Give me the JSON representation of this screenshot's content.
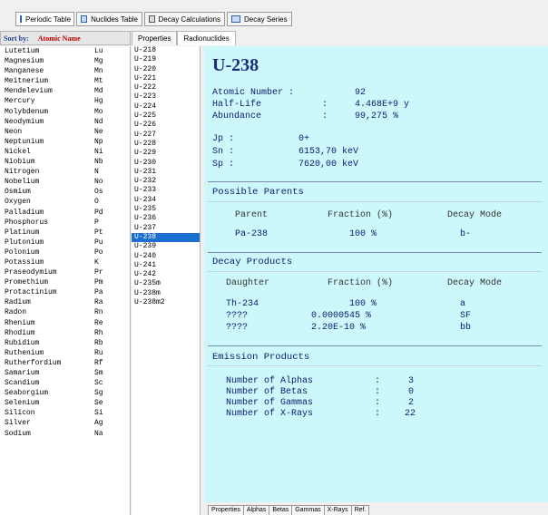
{
  "top_tabs": [
    {
      "label": "Periodic Table",
      "icon": "periodic-table-icon"
    },
    {
      "label": "Nuclides Table",
      "icon": "nuclides-table-icon"
    },
    {
      "label": "Decay Calculations",
      "icon": "calculator-icon"
    },
    {
      "label": "Decay Series",
      "icon": "decay-series-icon"
    }
  ],
  "sort": {
    "label": "Sort by:",
    "value": "Atomic Name"
  },
  "sub_tabs": [
    {
      "label": "Properties"
    },
    {
      "label": "Radionuclides"
    }
  ],
  "elements": [
    {
      "name": "Lutetium",
      "symbol": "Lu"
    },
    {
      "name": "Magnesium",
      "symbol": "Mg"
    },
    {
      "name": "Manganese",
      "symbol": "Mn"
    },
    {
      "name": "Meitnerium",
      "symbol": "Mt"
    },
    {
      "name": "Mendelevium",
      "symbol": "Md"
    },
    {
      "name": "Mercury",
      "symbol": "Hg"
    },
    {
      "name": "Molybdenum",
      "symbol": "Mo"
    },
    {
      "name": "Neodymium",
      "symbol": "Nd"
    },
    {
      "name": "Neon",
      "symbol": "Ne"
    },
    {
      "name": "Neptunium",
      "symbol": "Np"
    },
    {
      "name": "Nickel",
      "symbol": "Ni"
    },
    {
      "name": "Niobium",
      "symbol": "Nb"
    },
    {
      "name": "Nitrogen",
      "symbol": "N"
    },
    {
      "name": "Nobelium",
      "symbol": "No"
    },
    {
      "name": "Osmium",
      "symbol": "Os"
    },
    {
      "name": "Oxygen",
      "symbol": "O"
    },
    {
      "name": "Palladium",
      "symbol": "Pd"
    },
    {
      "name": "Phosphorus",
      "symbol": "P"
    },
    {
      "name": "Platinum",
      "symbol": "Pt"
    },
    {
      "name": "Plutonium",
      "symbol": "Pu"
    },
    {
      "name": "Polonium",
      "symbol": "Po"
    },
    {
      "name": "Potassium",
      "symbol": "K"
    },
    {
      "name": "Praseodymium",
      "symbol": "Pr"
    },
    {
      "name": "Promethium",
      "symbol": "Pm"
    },
    {
      "name": "Protactinium",
      "symbol": "Pa"
    },
    {
      "name": "Radium",
      "symbol": "Ra"
    },
    {
      "name": "Radon",
      "symbol": "Rn"
    },
    {
      "name": "Rhenium",
      "symbol": "Re"
    },
    {
      "name": "Rhodium",
      "symbol": "Rh"
    },
    {
      "name": "Rubidium",
      "symbol": "Rb"
    },
    {
      "name": "Ruthenium",
      "symbol": "Ru"
    },
    {
      "name": "Rutherfordium",
      "symbol": "Rf"
    },
    {
      "name": "Samarium",
      "symbol": "Sm"
    },
    {
      "name": "Scandium",
      "symbol": "Sc"
    },
    {
      "name": "Seaborgium",
      "symbol": "Sg"
    },
    {
      "name": "Selenium",
      "symbol": "Se"
    },
    {
      "name": "Silicon",
      "symbol": "Si"
    },
    {
      "name": "Silver",
      "symbol": "Ag"
    },
    {
      "name": "Sodium",
      "symbol": "Na"
    }
  ],
  "nuclides": [
    "U-218",
    "U-219",
    "U-220",
    "U-221",
    "U-222",
    "U-223",
    "U-224",
    "U-225",
    "U-226",
    "U-227",
    "U-228",
    "U-229",
    "U-230",
    "U-231",
    "U-232",
    "U-233",
    "U-234",
    "U-235",
    "U-236",
    "U-237",
    "U-238",
    "U-239",
    "U-240",
    "U-241",
    "U-242",
    "U-235m",
    "U-238m",
    "U-238m2"
  ],
  "selected_nuclide": "U-238",
  "detail": {
    "title": "U-238",
    "atomic_number_label": "Atomic Number :",
    "atomic_number": "92",
    "half_life_label": "Half-Life",
    "half_life": "4.468E+9 y",
    "abundance_label": "Abundance",
    "abundance": "99,275 %",
    "colon": ":",
    "jp_label": "Jp :",
    "jp": "0+",
    "sn_label": "Sn :",
    "sn": "6153,70 keV",
    "sp_label": "Sp :",
    "sp": "7620,00 keV",
    "parents_title": "Possible Parents",
    "parents_headers": [
      "Parent",
      "Fraction (%)",
      "Decay Mode"
    ],
    "parents": [
      {
        "nuclide": "Pa-238",
        "fraction": "100 %",
        "mode": "b-"
      }
    ],
    "products_title": "Decay Products",
    "products_headers": [
      "Daughter",
      "Fraction (%)",
      "Decay Mode"
    ],
    "products": [
      {
        "nuclide": "Th-234",
        "fraction": "100 %",
        "mode": "a"
      },
      {
        "nuclide": "????",
        "fraction": "0.0000545 %",
        "mode": "SF"
      },
      {
        "nuclide": "????",
        "fraction": "2.20E-10 %",
        "mode": "bb"
      }
    ],
    "emission_title": "Emission Products",
    "emissions": [
      {
        "label": "Number of Alphas",
        "value": "3"
      },
      {
        "label": "Number of Betas",
        "value": "0"
      },
      {
        "label": "Number of Gammas",
        "value": "2"
      },
      {
        "label": "Number of X-Rays",
        "value": "22"
      }
    ]
  },
  "bottom_tabs": [
    "Properties",
    "Alphas",
    "Betas",
    "Gammas",
    "X-Rays",
    "Ref."
  ]
}
